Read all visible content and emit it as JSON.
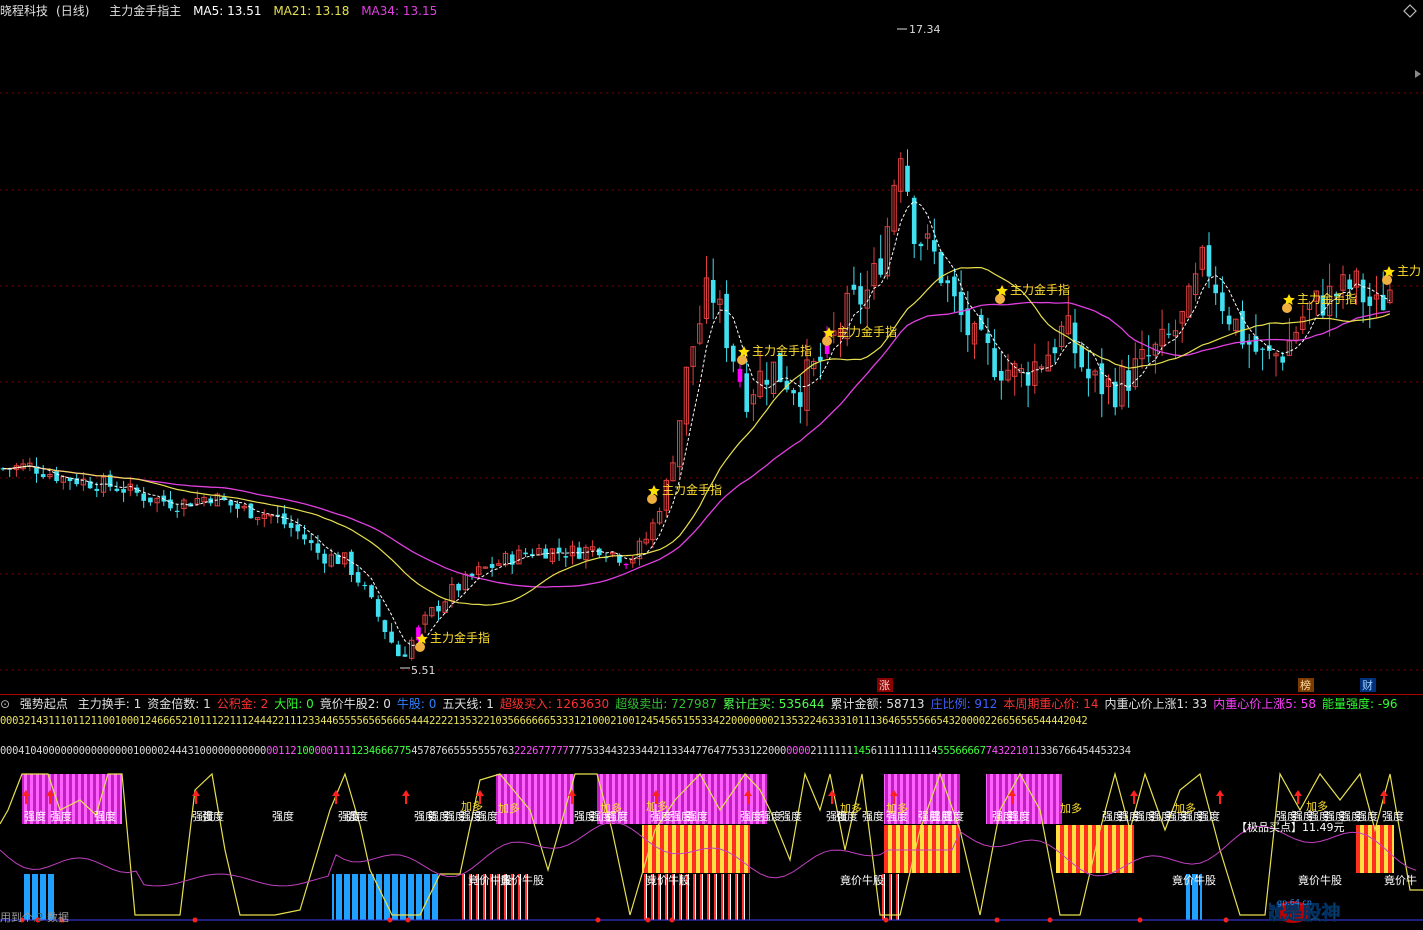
{
  "header": {
    "stock_name": "晓程科技",
    "period": "(日线)",
    "indicator_name": "主力金手指主",
    "ma5": "MA5: 13.51",
    "ma21": "MA21: 13.18",
    "ma34": "MA34: 13.15"
  },
  "main_chart": {
    "high_label": "17.34",
    "low_label": "5.51",
    "signal_label": "主力金手指",
    "signal_label_truncated": "主力",
    "flags": {
      "zhang": "涨",
      "bang": "榜",
      "cai": "财"
    },
    "colors": {
      "up": "#e04040",
      "down": "#40e0f0",
      "signal_bar": "#ff00ff",
      "ma5": "#ffffff",
      "ma21": "#e8e050",
      "ma34": "#e040e0"
    }
  },
  "indicator_header": {
    "name": "强势起点",
    "items": [
      {
        "label": "主力换手",
        "value": "1",
        "color": "#e0e0e0"
      },
      {
        "label": "资金倍数",
        "value": "1",
        "color": "#e0e0e0"
      },
      {
        "label": "公积金",
        "value": "2",
        "color": "#ff3030"
      },
      {
        "label": "大阳",
        "value": "0",
        "color": "#30ff30"
      },
      {
        "label": "竟价牛股2",
        "value": "0",
        "color": "#e0e0e0"
      },
      {
        "label": "牛股",
        "value": "0",
        "color": "#3080ff"
      },
      {
        "label": "五天线",
        "value": "1",
        "color": "#e0e0e0"
      },
      {
        "label": "超级买入",
        "value": "1263630",
        "color": "#ff3030"
      },
      {
        "label": "超级卖出",
        "value": "727987",
        "color": "#30c030"
      },
      {
        "label": "累计庄买",
        "value": "535644",
        "color": "#50ff50"
      },
      {
        "label": "累计金额",
        "value": "58713",
        "color": "#e0e0e0"
      },
      {
        "label": "庄比例",
        "value": "912",
        "color": "#4060ff"
      },
      {
        "label": "本周期重心价",
        "value": "14",
        "color": "#ff3030"
      },
      {
        "label": "内重心价上涨1",
        "value": "33",
        "color": "#e0e0e0"
      },
      {
        "label": "内重心价上涨5",
        "value": "58",
        "color": "#ff40ff"
      },
      {
        "label": "能量强度",
        "value": "-96",
        "color": "#30ff30"
      }
    ]
  },
  "digit_rows": {
    "row1": "000321431110112110010001246665210111221112444221112334465555656566654442222135322103566666653331210002100124545651553342200000002135322463331011136465555665432000022665656544442042",
    "row2": "0004104000000000000000100002444310000000000000112100000111123466677545787665555555763222677777777533443233442113344776477533122000000021111111456111111111455566667743221011336766454453234"
  },
  "sub_chart": {
    "strength_label": "强度",
    "add_label": "加多",
    "auction_label": "竟价牛股",
    "auction_label_short": "竟价牛",
    "buy_point_label": "【极品买点】11.49元"
  },
  "footer": {
    "left_text": "用到个",
    "left_text2": "数据"
  },
  "watermark": {
    "text": "你就是股神",
    "site": "gp.64.cn"
  }
}
